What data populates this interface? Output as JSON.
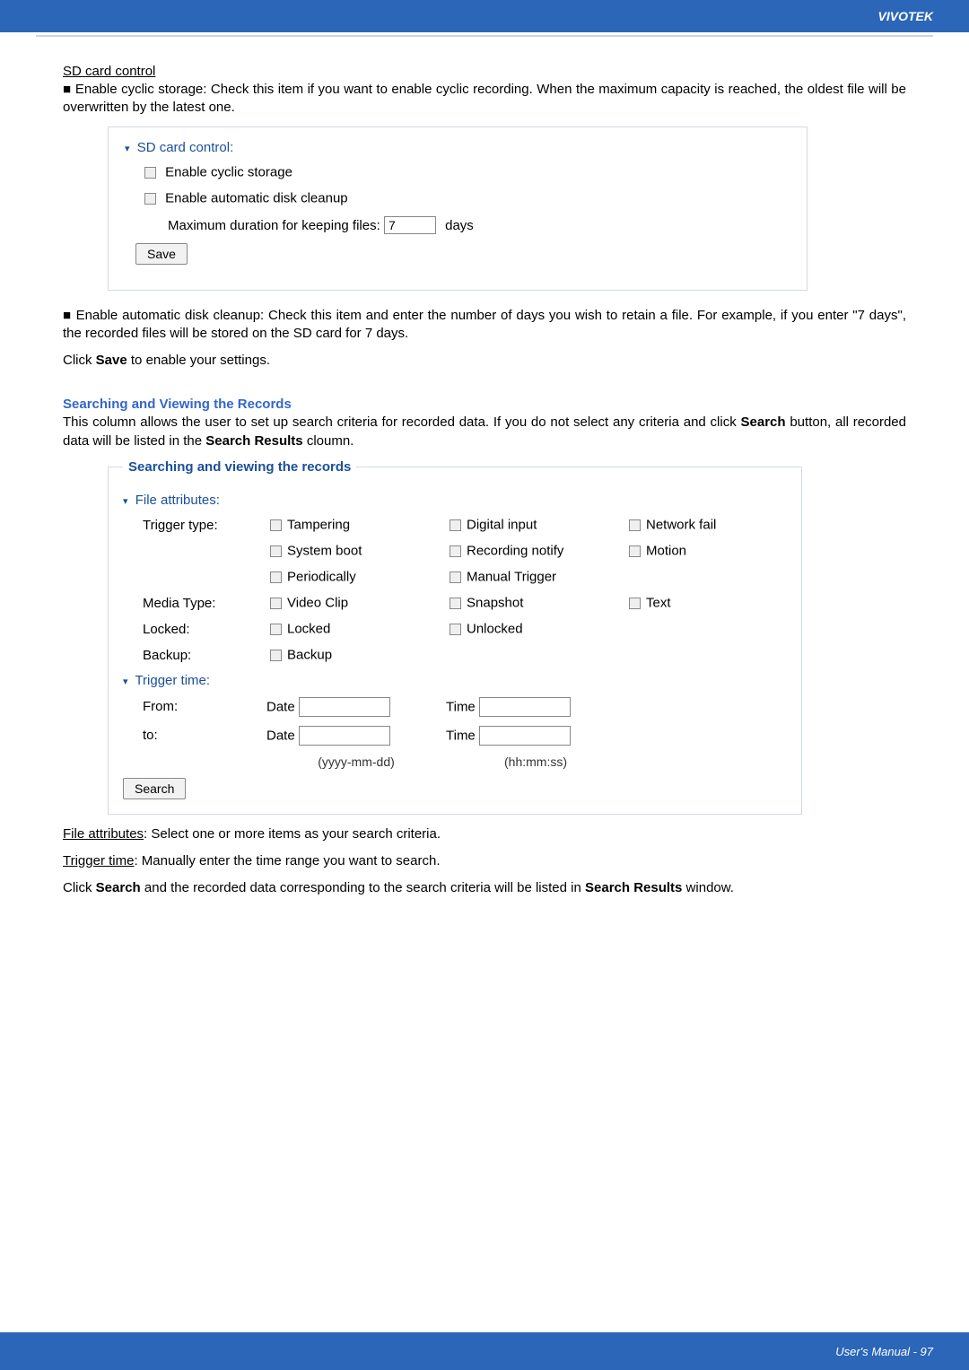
{
  "header": {
    "brand": "VIVOTEK"
  },
  "sd_control": {
    "heading": "SD card control",
    "bullet1": "■ Enable cyclic storage: Check this item if you want to enable cyclic recording. When the maximum capacity is reached, the oldest file will be overwritten by the latest one.",
    "panel_title": "SD card control:",
    "cyclic": "Enable cyclic storage",
    "cleanup": "Enable automatic disk cleanup",
    "max_label": "Maximum duration for keeping files:",
    "max_value": "7",
    "days": "days",
    "save": "Save",
    "bullet2": "■ Enable automatic disk cleanup: Check this item and enter the number of days you wish to retain a file. For example, if you enter \"7 days\", the recorded files will be stored on the SD card for 7 days.",
    "click_save_prefix": "Click ",
    "click_save_bold": "Save",
    "click_save_suffix": " to enable your settings."
  },
  "searching": {
    "heading": "Searching and Viewing the Records",
    "intro_a": "This column allows the user to set up search criteria for recorded data. If you do not select any criteria and click ",
    "intro_b": "Search",
    "intro_c": " button, all recorded data will be listed in the ",
    "intro_d": "Search Results",
    "intro_e": " cloumn.",
    "legend": "Searching and viewing the records",
    "file_attrs": "File attributes:",
    "trigger_type": "Trigger type:",
    "tampering": "Tampering",
    "digital_input": "Digital input",
    "network_fail": "Network fail",
    "system_boot": "System boot",
    "recording_notify": "Recording notify",
    "motion": "Motion",
    "periodically": "Periodically",
    "manual_trigger": "Manual Trigger",
    "media_type": "Media Type:",
    "video_clip": "Video Clip",
    "snapshot": "Snapshot",
    "text": "Text",
    "locked_label": "Locked:",
    "locked": "Locked",
    "unlocked": "Unlocked",
    "backup_label": "Backup:",
    "backup": "Backup",
    "trigger_time": "Trigger time:",
    "from": "From:",
    "to": "to:",
    "date": "Date",
    "time": "Time",
    "date_hint": "(yyyy-mm-dd)",
    "time_hint": "(hh:mm:ss)",
    "search": "Search",
    "file_attr_text_u": "File attributes",
    "file_attr_text": ": Select one or more items as your search criteria.",
    "trigger_time_u": "Trigger time",
    "trigger_time_text": ": Manually enter the time range you want to search.",
    "click_search_a": "Click ",
    "click_search_b": "Search",
    "click_search_c": " and the recorded data corresponding to the search criteria will be listed in ",
    "click_search_d": "Search Results",
    "click_search_e": " window."
  },
  "footer": {
    "text": "User's Manual - 97"
  }
}
